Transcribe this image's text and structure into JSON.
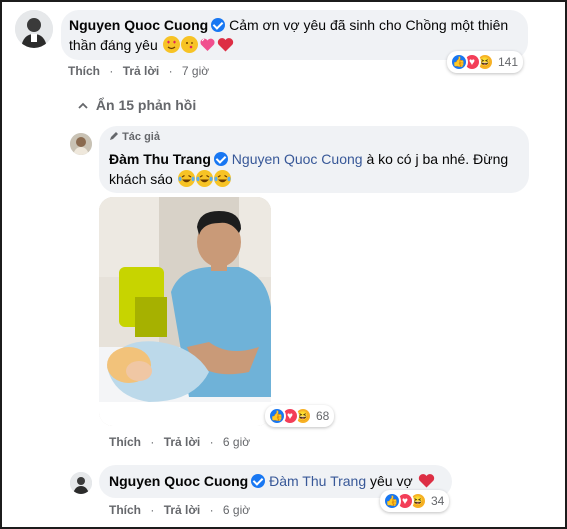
{
  "comment1": {
    "author": "Nguyen Quoc Cuong",
    "text_line1": "Cảm ơn vợ yêu đã sinh cho Chồng một thiên",
    "text_line2": "thần đáng yêu",
    "actions": {
      "like": "Thích",
      "reply": "Trả lời",
      "time": "7 giờ"
    },
    "reaction_count": "141"
  },
  "hide_replies": {
    "label": "Ẩn 15 phản hồi"
  },
  "reply1": {
    "badge": "Tác giả",
    "author": "Đàm Thu Trang",
    "mention": "Nguyen Quoc Cuong",
    "text_line1": "à ko có j ba nhé. Đừng",
    "text_line2": "khách sáo",
    "actions": {
      "like": "Thích",
      "reply": "Trả lời",
      "time": "6 giờ"
    },
    "reaction_count": "68"
  },
  "reply2": {
    "author": "Nguyen Quoc Cuong",
    "mention": "Đàm Thu Trang",
    "text": "yêu vợ",
    "actions": {
      "like": "Thích",
      "reply": "Trả lời",
      "time": "6 giờ"
    },
    "reaction_count": "34"
  },
  "colors": {
    "bubble": "#f0f2f5",
    "like": "#1877f2",
    "love": "#f33e58",
    "haha": "#f7b125",
    "mention": "#385898",
    "meta": "#65676b"
  },
  "icons": [
    "verified-icon",
    "like-icon",
    "love-icon",
    "haha-icon",
    "pen-icon",
    "chevron-up-icon"
  ]
}
